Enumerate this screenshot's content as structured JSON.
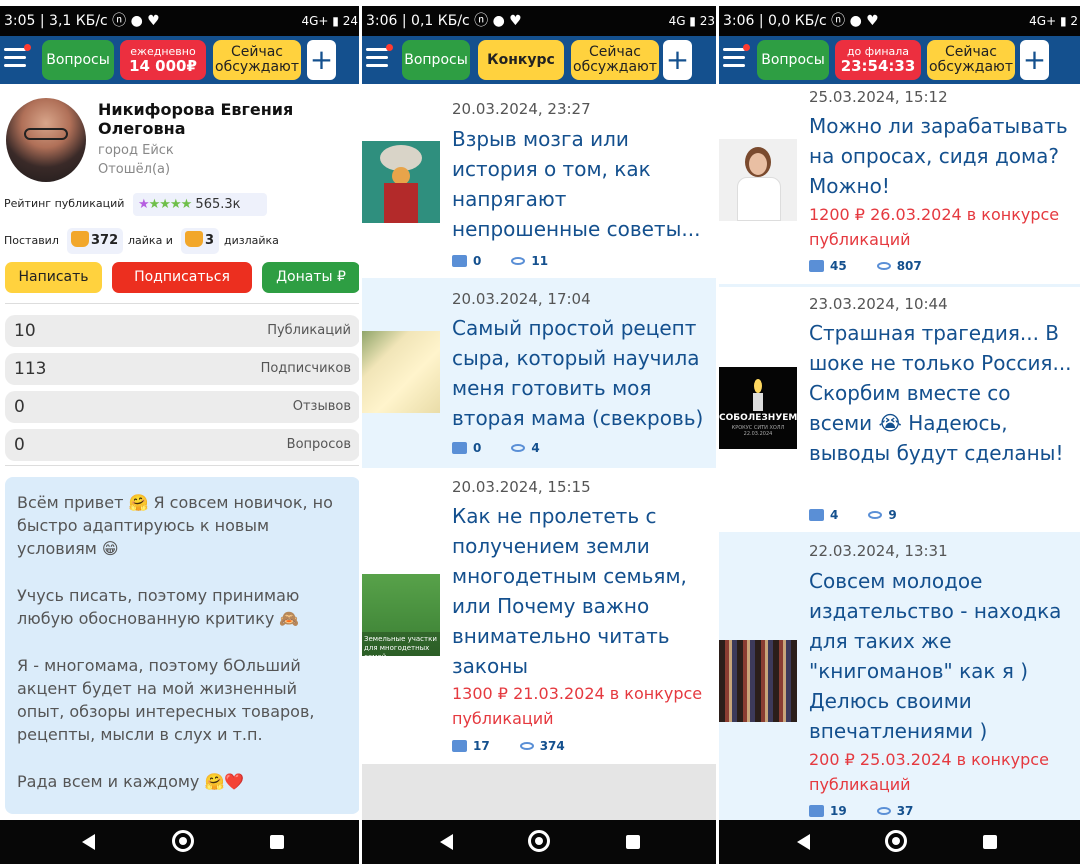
{
  "colors": {
    "appbar": "#14508e",
    "green": "#2e9e43",
    "red": "#ec2f3f",
    "yellow": "#ffd23e",
    "link": "#14508e",
    "prize": "#e5393f",
    "card_alt": "#e8f4fd",
    "about_bg": "#dbecfa"
  },
  "panel1": {
    "status": {
      "left": "3:05 | 3,1 КБ/с ⓝ ● ♥",
      "right": "4G+ ▮ 24"
    },
    "appbar": {
      "btn_questions": "Вопросы",
      "btn_daily_top": "ежедневно",
      "btn_daily_bottom": "14 000₽",
      "btn_now_line1": "Сейчас",
      "btn_now_line2": "обсуждают",
      "btn_plus": "+"
    },
    "profile": {
      "name": "Никифорова Евгения Олеговна",
      "city": "город  Ейск",
      "status": "Отошёл(а)",
      "rating_label": "Рейтинг публикаций",
      "rating_value": "565.3к",
      "likes_prefix": "Поставил",
      "likes_count": "372",
      "likes_mid": "лайка и",
      "dislikes_count": "3",
      "dislikes_suffix": "дизлайка",
      "btn_write": "Написать",
      "btn_subscribe": "Подписаться",
      "btn_donate": "Донаты ₽"
    },
    "stats": [
      {
        "value": "10",
        "label": "Публикаций"
      },
      {
        "value": "113",
        "label": "Подписчиков"
      },
      {
        "value": "0",
        "label": "Отзывов"
      },
      {
        "value": "0",
        "label": "Вопросов"
      }
    ],
    "about": [
      "Всём привет 🤗 Я совсем новичок, но быстро адаптируюсь к новым условиям 😁",
      "Учусь писать, поэтому принимаю любую обоснованную критику 🙈",
      "Я - многомама, поэтому бОльший акцент будет на мой жизненный опыт, обзоры интересных товаров, рецепты, мысли в слух и т.п.",
      "Рада всем и каждому 🤗❤️"
    ]
  },
  "panel2": {
    "status": {
      "left": "3:06 | 0,1 КБ/с ⓝ ● ♥",
      "right": "4G ▮ 23"
    },
    "appbar": {
      "btn_questions": "Вопросы",
      "btn_contest": "Конкурс",
      "btn_now_line1": "Сейчас",
      "btn_now_line2": "обсуждают",
      "btn_plus": "+"
    },
    "posts": [
      {
        "date": "20.03.2024, 23:27",
        "title": "Взрыв мозга или история о том, как напрягают непрошенные советы...",
        "prize": "",
        "comments": "0",
        "views": "11"
      },
      {
        "date": "20.03.2024, 17:04",
        "title": "Самый простой рецепт сыра, который научила меня готовить моя вторая мама (свекровь)",
        "prize": "",
        "comments": "0",
        "views": "4"
      },
      {
        "date": "20.03.2024, 15:15",
        "title": "Как не пролететь с получением земли многодетным семьям, или Почему важно внимательно читать законы",
        "prize": "1300 ₽ 21.03.2024 в конкурсе публикаций",
        "comments": "17",
        "views": "374",
        "img_text": "Земельные участки для многодетных семей"
      }
    ]
  },
  "panel3": {
    "status": {
      "left": "3:06 | 0,0 КБ/с ⓝ ● ♥",
      "right": "4G+ ▮ 2"
    },
    "appbar": {
      "btn_questions": "Вопросы",
      "btn_final_top": "до финала",
      "btn_final_bottom": "23:54:33",
      "btn_now_line1": "Сейчас",
      "btn_now_line2": "обсуждают",
      "btn_plus": "+"
    },
    "posts": [
      {
        "date": "25.03.2024, 15:12",
        "title": "Можно ли зарабатывать на опросах, сидя дома? Можно!",
        "prize": "1200 ₽ 26.03.2024 в конкурсе публикаций",
        "comments": "45",
        "views": "807"
      },
      {
        "date": "23.03.2024, 10:44",
        "title": "Страшная трагедия... В шоке не только Россия... Скорбим вместе со всеми 😭 Надеюсь, выводы будут сделаны!",
        "prize": "",
        "comments": "4",
        "views": "9",
        "img_text": "СОБОЛЕЗНУЕМ",
        "img_sub": "КРОКУС СИТИ ХОЛЛ 22.03.2024"
      },
      {
        "date": "22.03.2024, 13:31",
        "title": "Совсем молодое издательство - находка для таких же \"книгоманов\" как я ) Делюсь своими впечатлениями )",
        "prize": "200 ₽ 25.03.2024 в конкурсе публикаций",
        "comments": "19",
        "views": "37"
      }
    ]
  }
}
